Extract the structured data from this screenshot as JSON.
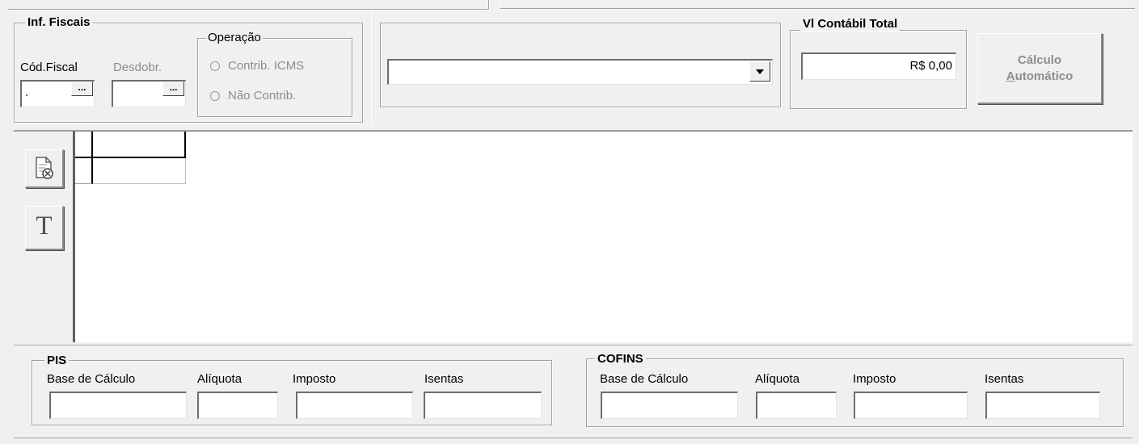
{
  "fiscal": {
    "group_label": "Inf. Fiscais",
    "cod_fiscal_label": "Cód.Fiscal",
    "cod_fiscal_value": ".",
    "desdobr_label": "Desdobr.",
    "desdobr_value": "",
    "lookup_button_label": "...",
    "operacao": {
      "label": "Operação",
      "options": [
        "Contrib. ICMS",
        "Não Contrib."
      ]
    }
  },
  "combo": {
    "value": ""
  },
  "total": {
    "label": "Vl Contábil Total",
    "value": "R$ 0,00"
  },
  "calc_button": {
    "line1": "Cálculo",
    "line2_accel": "A",
    "line2_rest": "utomático"
  },
  "side_tools": {
    "text_button_label": "T"
  },
  "grid": {
    "rows": [
      [
        "",
        ""
      ]
    ]
  },
  "pis": {
    "label": "PIS",
    "fields": [
      {
        "label": "Base de Cálculo",
        "value": ""
      },
      {
        "label": "Alíquota",
        "value": ""
      },
      {
        "label": "Imposto",
        "value": ""
      },
      {
        "label": "Isentas",
        "value": ""
      }
    ]
  },
  "cofins": {
    "label": "COFINS",
    "fields": [
      {
        "label": "Base de Cálculo",
        "value": ""
      },
      {
        "label": "Alíquota",
        "value": ""
      },
      {
        "label": "Imposto",
        "value": ""
      },
      {
        "label": "Isentas",
        "value": ""
      }
    ]
  }
}
